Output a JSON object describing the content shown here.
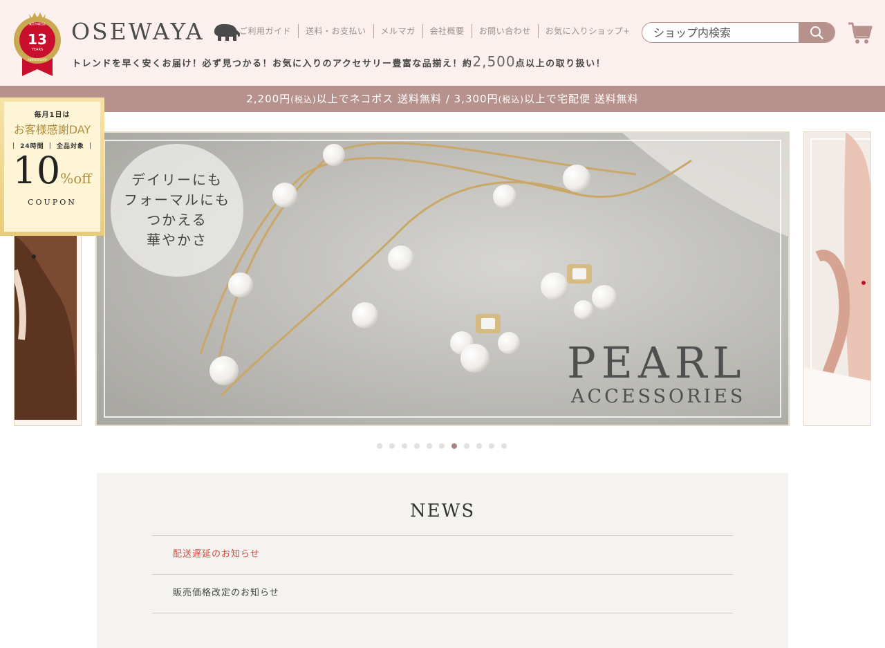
{
  "header": {
    "badge": {
      "rakuten_label": "楽天市場出店",
      "number": "13",
      "years": "YEARS",
      "anniversary": "ANNIVERSARY"
    },
    "logo": "OSEWAYA",
    "tagline_pre": "トレンドを早く安くお届け！必ず見つかる！お気に入りのアクセサリー豊富な品揃え！約",
    "tagline_num": "2,500",
    "tagline_post": "点以上の取り扱い！",
    "nav": [
      "ご利用ガイド",
      "送料・お支払い",
      "メルマガ",
      "会社概要",
      "お問い合わせ",
      "お気に入りショップ+"
    ],
    "search_placeholder": "ショップ内検索",
    "icons": {
      "search": "search-icon",
      "cart": "cart-icon",
      "logo_mark": "elephant-icon"
    }
  },
  "shipping": {
    "p1": "2,200円",
    "p1_tax": "(税込)",
    "p1_text": "以上でネコポス 送料無料 / 3,300円",
    "p2_tax": "(税込)",
    "p2_text": "以上で宅配便 送料無料"
  },
  "coupon": {
    "line1": "毎月1日は",
    "line2": "お客様感謝DAY",
    "line3": "｜ 24時間 ｜ 全品対象 ｜",
    "discount": "10",
    "percent": "%",
    "off": "off",
    "label": "COUPON"
  },
  "carousel": {
    "bubble": [
      "デイリーにも",
      "フォーマルにも",
      "つかえる",
      "華やかさ"
    ],
    "title": "PEARL",
    "subtitle": "ACCESSORIES",
    "slide_count": 11,
    "active_index": 6
  },
  "news": {
    "title": "NEWS",
    "items": [
      {
        "text": "配送遅延のお知らせ",
        "highlight": true
      },
      {
        "text": "販売価格改定のお知らせ",
        "highlight": false
      }
    ]
  },
  "colors": {
    "header_bg": "#fcf0ee",
    "accent": "#b7928c",
    "news_red": "#d04b3b"
  }
}
